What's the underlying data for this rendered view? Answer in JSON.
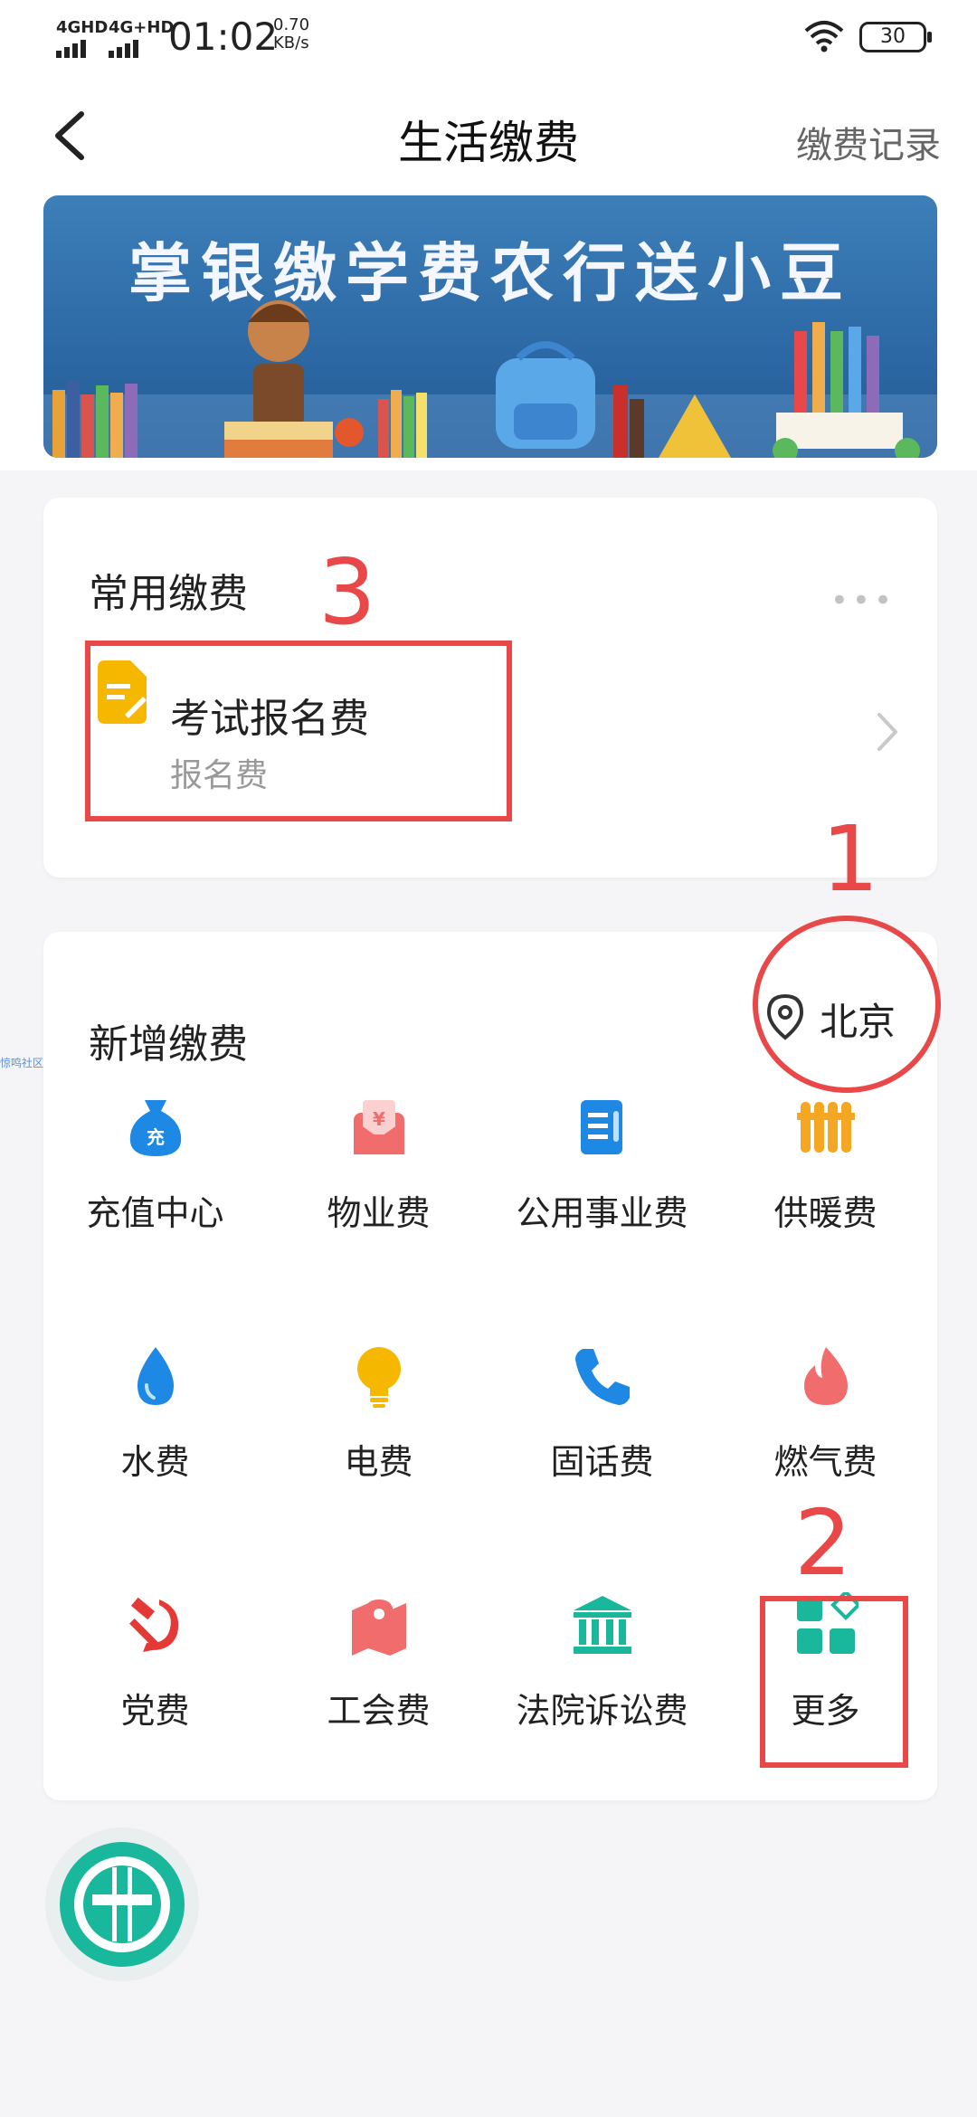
{
  "status_bar": {
    "network_1": "4GHD",
    "network_2": "4G+HD",
    "time": "01:02",
    "speed_value": "0.70",
    "speed_unit": "KB/s",
    "battery": "30"
  },
  "nav": {
    "title": "生活缴费",
    "record_label": "缴费记录"
  },
  "banner": {
    "text": "掌银缴学费农行送小豆"
  },
  "common": {
    "title": "常用缴费",
    "item_name": "考试报名费",
    "item_sub": "报名费"
  },
  "new_payments": {
    "title": "新增缴费",
    "location": "北京",
    "items": [
      {
        "label": "充值中心",
        "icon": "money-bag-icon"
      },
      {
        "label": "物业费",
        "icon": "property-envelope-icon"
      },
      {
        "label": "公用事业费",
        "icon": "document-icon"
      },
      {
        "label": "供暖费",
        "icon": "radiator-icon"
      },
      {
        "label": "水费",
        "icon": "water-drop-icon"
      },
      {
        "label": "电费",
        "icon": "lightbulb-icon"
      },
      {
        "label": "固话费",
        "icon": "phone-icon"
      },
      {
        "label": "燃气费",
        "icon": "flame-icon"
      },
      {
        "label": "党费",
        "icon": "hammer-sickle-icon"
      },
      {
        "label": "工会费",
        "icon": "map-pin-icon"
      },
      {
        "label": "法院诉讼费",
        "icon": "courthouse-icon"
      },
      {
        "label": "更多",
        "icon": "more-grid-icon"
      }
    ]
  },
  "annotations": {
    "n1": "1",
    "n2": "2",
    "n3": "3"
  },
  "watermark": "惊鸣社区",
  "colors": {
    "accent_red": "#e94848",
    "blue": "#1e88e5",
    "orange": "#f5a623",
    "coral": "#f16d6d",
    "teal": "#19b79c"
  }
}
